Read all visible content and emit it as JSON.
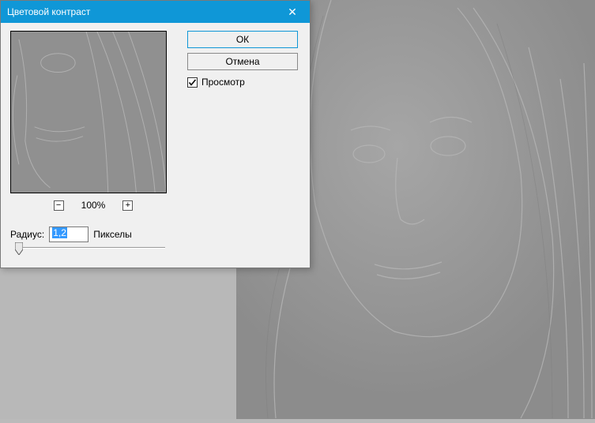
{
  "dialog": {
    "title": "Цветовой контраст",
    "ok_label": "ОК",
    "cancel_label": "Отмена",
    "preview_checkbox_label": "Просмотр",
    "preview_checked": true,
    "zoom_value": "100%",
    "zoom_minus": "−",
    "zoom_plus": "+",
    "radius_label": "Радиус:",
    "radius_value": "1,2",
    "radius_unit": "Пикселы",
    "slider_position_percent": 2
  },
  "icons": {
    "close": "✕",
    "checkmark": "✓"
  }
}
